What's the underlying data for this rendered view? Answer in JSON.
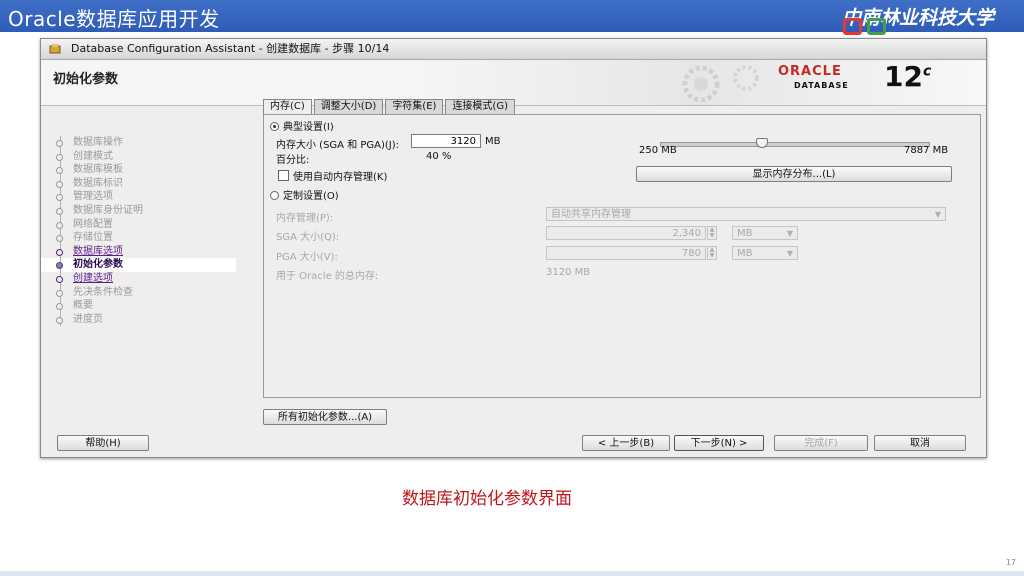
{
  "banner": {
    "title": "Oracle数据库应用开发",
    "school": "中南林业科技大学"
  },
  "window": {
    "title": "Database Configuration Assistant - 创建数据库 - 步骤 10/14",
    "header": "初始化参数",
    "oracle_brand": "ORACLE",
    "oracle_database": "DATABASE",
    "version": "12",
    "version_sup": "c"
  },
  "steps": [
    {
      "label": "数据库操作",
      "state": "done"
    },
    {
      "label": "创建模式",
      "state": "done"
    },
    {
      "label": "数据库模板",
      "state": "done"
    },
    {
      "label": "数据库标识",
      "state": "done"
    },
    {
      "label": "管理选项",
      "state": "done"
    },
    {
      "label": "数据库身份证明",
      "state": "done"
    },
    {
      "label": "网络配置",
      "state": "done"
    },
    {
      "label": "存储位置",
      "state": "done"
    },
    {
      "label": "数据库选项",
      "state": "link"
    },
    {
      "label": "初始化参数",
      "state": "current"
    },
    {
      "label": "创建选项",
      "state": "link"
    },
    {
      "label": "先决条件检查",
      "state": "future"
    },
    {
      "label": "概要",
      "state": "future"
    },
    {
      "label": "进度页",
      "state": "future"
    }
  ],
  "tabs": [
    "内存(C)",
    "调整大小(D)",
    "字符集(E)",
    "连接模式(G)"
  ],
  "memory": {
    "typical_label": "典型设置(I)",
    "size_label": "内存大小 (SGA 和 PGA)(J):",
    "size_value": "3120",
    "size_unit": "MB",
    "percent_label": "百分比:",
    "percent_value": "40 %",
    "slider_min": "250 MB",
    "slider_max": "7887 MB",
    "slider_fraction": 0.38,
    "auto_mem_label": "使用自动内存管理(K)",
    "show_dist_button": "显示内存分布...(L)",
    "custom_label": "定制设置(O)",
    "mgmt_label": "内存管理(P):",
    "mgmt_value": "自动共享内存管理",
    "sga_label": "SGA 大小(Q):",
    "sga_value": "2,340",
    "sga_unit": "MB",
    "pga_label": "PGA 大小(V):",
    "pga_value": "780",
    "pga_unit": "MB",
    "total_label": "用于 Oracle 的总内存:",
    "total_value": "3120 MB"
  },
  "buttons": {
    "all_params": "所有初始化参数...(A)",
    "help": "帮助(H)",
    "back": "< 上一步(B)",
    "next": "下一步(N) >",
    "finish": "完成(F)",
    "cancel": "取消"
  },
  "caption": "数据库初始化参数界面",
  "page_number": "17",
  "colors": {
    "banner": "#2e5cb8",
    "caption": "#c0151b",
    "oracle_red": "#c62828",
    "current_step": "#2b0a55"
  }
}
